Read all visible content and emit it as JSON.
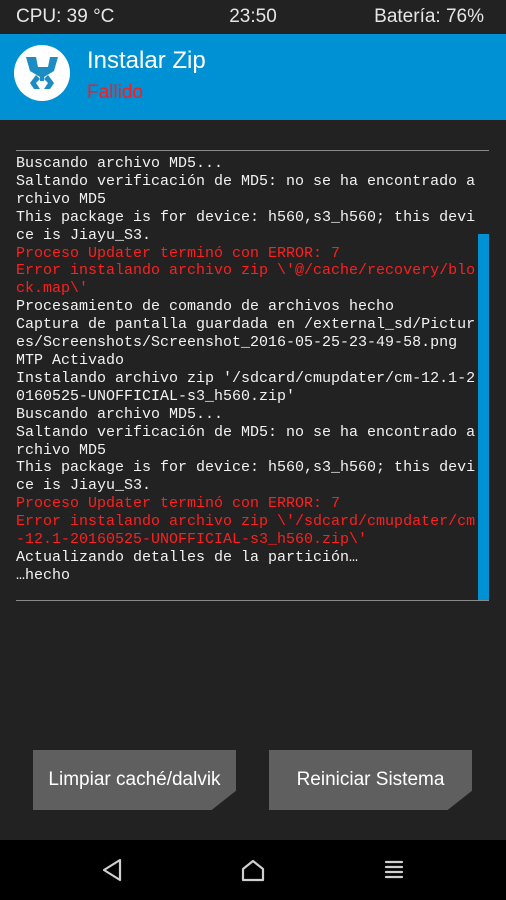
{
  "statusbar": {
    "cpu": "CPU: 39 °C",
    "time": "23:50",
    "battery": "Batería: 76%"
  },
  "header": {
    "title": "Instalar Zip",
    "status": "Fallido",
    "logo_icon": "twrp-logo-icon",
    "bg_color": "#0091d5",
    "status_color": "#ff1a1a"
  },
  "console": {
    "partial_top": "                          ",
    "lines": [
      {
        "text": "Buscando archivo MD5...",
        "error": false
      },
      {
        "text": "Saltando verificación de MD5: no se ha encontrado archivo MD5",
        "error": false
      },
      {
        "text": "This package is for device: h560,s3_h560; this device is Jiayu_S3.",
        "error": false
      },
      {
        "text": "Proceso Updater terminó con ERROR: 7",
        "error": true
      },
      {
        "text": "Error instalando archivo zip \\'@/cache/recovery/block.map\\'",
        "error": true
      },
      {
        "text": "Procesamiento de comando de archivos hecho",
        "error": false
      },
      {
        "text": "Captura de pantalla guardada en /external_sd/Pictures/Screenshots/Screenshot_2016-05-25-23-49-58.png",
        "error": false
      },
      {
        "text": "MTP Activado",
        "error": false
      },
      {
        "text": "Instalando archivo zip '/sdcard/cmupdater/cm-12.1-20160525-UNOFFICIAL-s3_h560.zip'",
        "error": false
      },
      {
        "text": "Buscando archivo MD5...",
        "error": false
      },
      {
        "text": "Saltando verificación de MD5: no se ha encontrado archivo MD5",
        "error": false
      },
      {
        "text": "This package is for device: h560,s3_h560; this device is Jiayu_S3.",
        "error": false
      },
      {
        "text": "Proceso Updater terminó con ERROR: 7",
        "error": true
      },
      {
        "text": "Error instalando archivo zip \\'/sdcard/cmupdater/cm-12.1-20160525-UNOFFICIAL-s3_h560.zip\\'",
        "error": true
      },
      {
        "text": "Actualizando detalles de la partición…",
        "error": false
      },
      {
        "text": "…hecho",
        "error": false
      }
    ]
  },
  "buttons": {
    "wipe_cache": "Limpiar caché/dalvik",
    "reboot_system": "Reiniciar Sistema"
  },
  "navbar": {
    "back_icon": "back-triangle-icon",
    "home_icon": "home-icon",
    "menu_icon": "menu-lines-icon"
  }
}
